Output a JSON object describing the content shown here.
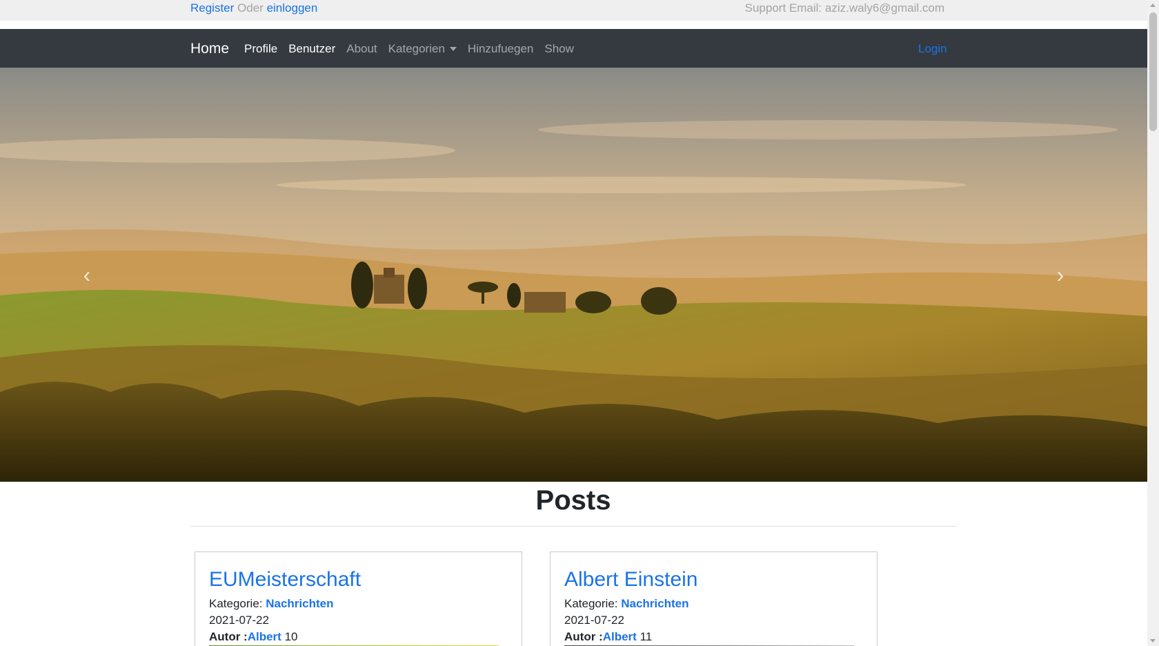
{
  "topbar": {
    "register": "Register",
    "oder": "Oder",
    "einloggen": "einloggen",
    "support": "Support Email: aziz.waly6@gmail.com"
  },
  "navbar": {
    "brand": "Home",
    "items": [
      {
        "label": "Profile",
        "active": true
      },
      {
        "label": "Benutzer",
        "active": true
      },
      {
        "label": "About",
        "active": false
      },
      {
        "label": "Kategorien",
        "active": false,
        "dropdown": true
      },
      {
        "label": "Hinzufuegen",
        "active": false
      },
      {
        "label": "Show",
        "active": false
      }
    ],
    "login": "Login"
  },
  "carousel": {
    "prev_icon": "chevron-left-icon",
    "next_icon": "chevron-right-icon",
    "prev_glyph": "‹",
    "next_glyph": "›"
  },
  "posts": {
    "heading": "Posts",
    "cards": [
      {
        "title": "EUMeisterschaft",
        "category_label": "Kategorie:",
        "category": "Nachrichten",
        "date": "2021-07-22",
        "author_label": "Autor :",
        "author": "Albert",
        "author_suffix": "10"
      },
      {
        "title": "Albert Einstein",
        "category_label": "Kategorie:",
        "category": "Nachrichten",
        "date": "2021-07-22",
        "author_label": "Autor :",
        "author": "Albert",
        "author_suffix": "11"
      }
    ]
  },
  "colors": {
    "link": "#1a73e8",
    "navbar_bg": "#343a40",
    "topbar_bg": "#efefef"
  }
}
